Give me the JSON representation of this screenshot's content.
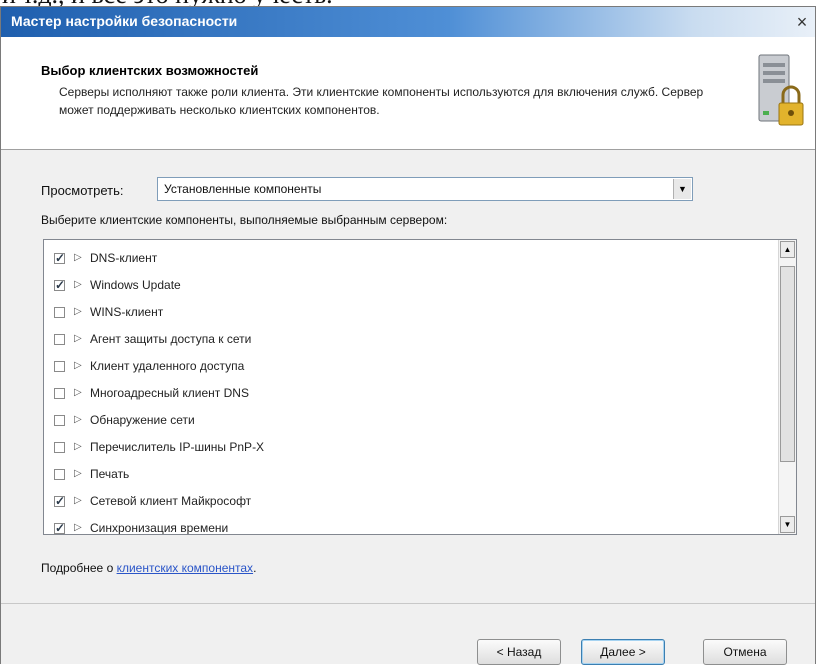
{
  "document": {
    "text_above": "и т.д., и все это нужно учесть."
  },
  "window": {
    "title": "Мастер настройки безопасности",
    "close_glyph": "×"
  },
  "header": {
    "title": "Выбор клиентских возможностей",
    "description": "Серверы исполняют также роли клиента. Эти клиентские компоненты используются для включения служб. Сервер может поддерживать несколько клиентских компонентов.",
    "icon": "server-lock-icon"
  },
  "view": {
    "label": "Просмотреть:",
    "selected": "Установленные компоненты"
  },
  "list": {
    "caption": "Выберите клиентские компоненты, выполняемые выбранным сервером:",
    "items": [
      {
        "label": "DNS-клиент",
        "checked": true
      },
      {
        "label": "Windows Update",
        "checked": true
      },
      {
        "label": "WINS-клиент",
        "checked": false
      },
      {
        "label": "Агент защиты доступа к сети",
        "checked": false
      },
      {
        "label": "Клиент удаленного доступа",
        "checked": false
      },
      {
        "label": "Многоадресный клиент DNS",
        "checked": false
      },
      {
        "label": "Обнаружение сети",
        "checked": false
      },
      {
        "label": "Перечислитель IP-шины PnP-X",
        "checked": false
      },
      {
        "label": "Печать",
        "checked": false
      },
      {
        "label": "Сетевой клиент Майкрософт",
        "checked": true
      },
      {
        "label": "Синхронизация времени",
        "checked": true
      }
    ]
  },
  "more": {
    "prefix": "Подробнее о ",
    "link": "клиентских компонентах",
    "suffix": "."
  },
  "buttons": {
    "back": "< Назад",
    "next": "Далее >",
    "cancel": "Отмена"
  },
  "colors": {
    "titlebar": "#1f5fae",
    "link": "#2a55c8"
  }
}
